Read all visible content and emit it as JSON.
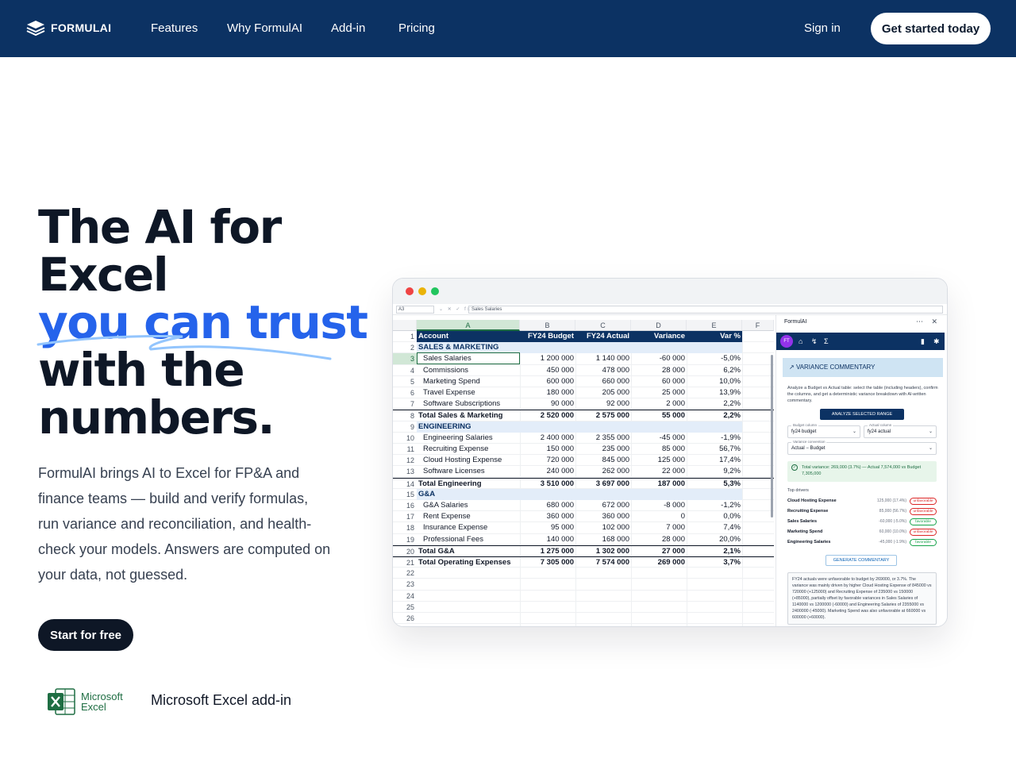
{
  "nav": {
    "brand": "FORMULAI",
    "links": [
      "Features",
      "Why FormulAI",
      "Add-in",
      "Pricing"
    ],
    "sign_in": "Sign in",
    "cta": "Get started today"
  },
  "hero": {
    "title_lines": [
      "The AI for",
      "Excel"
    ],
    "title_accent": "you can trust",
    "title_lines_after": [
      "with the",
      "numbers."
    ],
    "description": "FormulAI brings AI to Excel for FP&A and finance teams — build and verify formulas, run variance and reconciliation, and health-check your models. Answers are computed on your data, not guessed.",
    "cta": "Start for free",
    "badge_line1": "Microsoft",
    "badge_line2": "Excel",
    "addin_label": "Microsoft Excel add-in"
  },
  "colors": {
    "nav_bg": "#0c3263",
    "accent": "#2563eb",
    "dark": "#0e1726",
    "excel_green": "#1f6e43"
  },
  "formula_bar": {
    "name_box": "A3",
    "icons": "⌄ ✕ ✓ fx",
    "formula": "Sales Salaries"
  },
  "sheet": {
    "columns": [
      "A",
      "B",
      "C",
      "D",
      "E",
      "F"
    ],
    "rows": [
      {
        "n": "1",
        "type": "hdr",
        "a": "Account",
        "b": "FY24 Budget",
        "c": "FY24 Actual",
        "d": "Variance",
        "e": "Var %"
      },
      {
        "n": "2",
        "type": "sec",
        "a": "SALES & MARKETING",
        "b": "",
        "c": "",
        "d": "",
        "e": ""
      },
      {
        "n": "3",
        "type": "item",
        "a": "Sales Salaries",
        "b": "1 200 000",
        "c": "1 140 000",
        "d": "-60 000",
        "e": "-5,0%"
      },
      {
        "n": "4",
        "type": "item",
        "a": "Commissions",
        "b": "450 000",
        "c": "478 000",
        "d": "28 000",
        "e": "6,2%"
      },
      {
        "n": "5",
        "type": "item",
        "a": "Marketing Spend",
        "b": "600 000",
        "c": "660 000",
        "d": "60 000",
        "e": "10,0%"
      },
      {
        "n": "6",
        "type": "item",
        "a": "Travel Expense",
        "b": "180 000",
        "c": "205 000",
        "d": "25 000",
        "e": "13,9%"
      },
      {
        "n": "7",
        "type": "item",
        "a": "Software Subscriptions",
        "b": "90 000",
        "c": "92 000",
        "d": "2 000",
        "e": "2,2%"
      },
      {
        "n": "8",
        "type": "tot",
        "a": "Total Sales & Marketing",
        "b": "2 520 000",
        "c": "2 575 000",
        "d": "55 000",
        "e": "2,2%"
      },
      {
        "n": "9",
        "type": "sec",
        "a": "ENGINEERING",
        "b": "",
        "c": "",
        "d": "",
        "e": ""
      },
      {
        "n": "10",
        "type": "item",
        "a": "Engineering Salaries",
        "b": "2 400 000",
        "c": "2 355 000",
        "d": "-45 000",
        "e": "-1,9%"
      },
      {
        "n": "11",
        "type": "item",
        "a": "Recruiting Expense",
        "b": "150 000",
        "c": "235 000",
        "d": "85 000",
        "e": "56,7%"
      },
      {
        "n": "12",
        "type": "item",
        "a": "Cloud Hosting Expense",
        "b": "720 000",
        "c": "845 000",
        "d": "125 000",
        "e": "17,4%"
      },
      {
        "n": "13",
        "type": "item",
        "a": "Software Licenses",
        "b": "240 000",
        "c": "262 000",
        "d": "22 000",
        "e": "9,2%"
      },
      {
        "n": "14",
        "type": "tot",
        "a": "Total Engineering",
        "b": "3 510 000",
        "c": "3 697 000",
        "d": "187 000",
        "e": "5,3%"
      },
      {
        "n": "15",
        "type": "sec",
        "a": "G&A",
        "b": "",
        "c": "",
        "d": "",
        "e": ""
      },
      {
        "n": "16",
        "type": "item",
        "a": "G&A Salaries",
        "b": "680 000",
        "c": "672 000",
        "d": "-8 000",
        "e": "-1,2%"
      },
      {
        "n": "17",
        "type": "item",
        "a": "Rent Expense",
        "b": "360 000",
        "c": "360 000",
        "d": "0",
        "e": "0,0%"
      },
      {
        "n": "18",
        "type": "item",
        "a": "Insurance Expense",
        "b": "95 000",
        "c": "102 000",
        "d": "7 000",
        "e": "7,4%"
      },
      {
        "n": "19",
        "type": "item",
        "a": "Professional Fees",
        "b": "140 000",
        "c": "168 000",
        "d": "28 000",
        "e": "20,0%"
      },
      {
        "n": "20",
        "type": "tot",
        "a": "Total G&A",
        "b": "1 275 000",
        "c": "1 302 000",
        "d": "27 000",
        "e": "2,1%"
      },
      {
        "n": "21",
        "type": "tot",
        "a": "Total Operating Expenses",
        "b": "7 305 000",
        "c": "7 574 000",
        "d": "269 000",
        "e": "3,7%"
      },
      {
        "n": "22",
        "type": "empty",
        "a": "",
        "b": "",
        "c": "",
        "d": "",
        "e": ""
      },
      {
        "n": "23",
        "type": "empty",
        "a": "",
        "b": "",
        "c": "",
        "d": "",
        "e": ""
      },
      {
        "n": "24",
        "type": "empty",
        "a": "",
        "b": "",
        "c": "",
        "d": "",
        "e": ""
      },
      {
        "n": "25",
        "type": "empty",
        "a": "",
        "b": "",
        "c": "",
        "d": "",
        "e": ""
      },
      {
        "n": "26",
        "type": "empty",
        "a": "",
        "b": "",
        "c": "",
        "d": "",
        "e": ""
      }
    ]
  },
  "panel": {
    "title": "FormulAI",
    "controls": "⋯ ✕",
    "avatar": "FT",
    "section_title": "VARIANCE COMMENTARY",
    "description": "Analyze a Budget vs Actual table: select the table (including headers), confirm the columns, and get a deterministic variance breakdown with AI-written commentary.",
    "analyze_button": "ANALYZE SELECTED RANGE",
    "budget_label": "Budget column",
    "budget_value": "fy24 budget",
    "actual_label": "Actual column",
    "actual_value": "fy24 actual",
    "convention_label": "Variance convention",
    "convention_value": "Actual − Budget",
    "total_text": "Total variance: 269,000 (3.7%) — Actual 7,574,000 vs Budget 7,305,000",
    "drivers_label": "Top drivers",
    "drivers": [
      {
        "name": "Cloud Hosting Expense",
        "value": "125,000 (17.4%)",
        "tag": "unfavorable"
      },
      {
        "name": "Recruiting Expense",
        "value": "85,000 (56.7%)",
        "tag": "unfavorable"
      },
      {
        "name": "Sales Salaries",
        "value": "-60,000 (-5.0%)",
        "tag": "favorable"
      },
      {
        "name": "Marketing Spend",
        "value": "60,000 (10.0%)",
        "tag": "unfavorable"
      },
      {
        "name": "Engineering Salaries",
        "value": "-45,000 (-1.9%)",
        "tag": "favorable"
      }
    ],
    "generate_button": "GENERATE COMMENTARY",
    "commentary": "FY24 actuals were unfavorable to budget by 269000, or 3.7%. The variance was mainly driven by higher Cloud Hosting Expense of 845000 vs 720000 (+125000) and Recruiting Expense of 235000 vs 150000 (+85000), partially offset by favorable variances in Sales Salaries of 1140000 vs 1200000 (-60000) and Engineering Salaries of 2355000 vs 2400000 (-45000). Marketing Spend was also unfavorable at 660000 vs 600000 (+60000)."
  }
}
